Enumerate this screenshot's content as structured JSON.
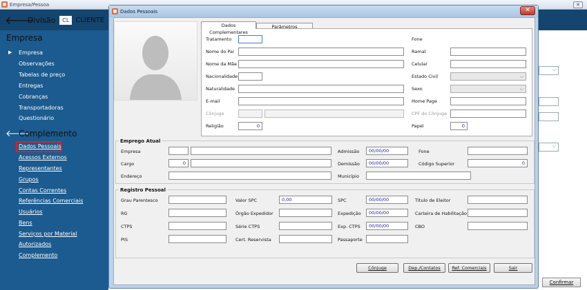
{
  "window": {
    "title": "Empresa/Pessoa",
    "close": "✕"
  },
  "nav": {
    "back": "🡐",
    "division": "Divisão",
    "cl": "CL",
    "client": "CLIENTE"
  },
  "sidebar": {
    "section1": "Empresa",
    "arrow": "▶",
    "items": [
      "Empresa",
      "Observações",
      "Tabelas de preço",
      "Entregas",
      "Cobranças",
      "Transportadoras",
      "Questionário"
    ],
    "section2": "Complemento",
    "links": [
      "Dados Pessoais",
      "Acessos Externos",
      "Representantes",
      "Grupos",
      "Contas Correntes",
      "Referências Comerciais",
      "Usuários",
      "Bens",
      "Serviços por Material",
      "Autorizados",
      "Complemento"
    ]
  },
  "background": {
    "confirm": "Confirmar"
  },
  "dialog": {
    "title": "Dados Pessoais",
    "close": "✕"
  },
  "tabs": [
    "Dados Complementares",
    "Parâmetros"
  ],
  "complementares": {
    "tratamento": "Tratamento",
    "nome_pai": "Nome do Pai",
    "nome_mae": "Nome da Mãe",
    "nacionalidade": "Nacionalidade",
    "naturalidade": "Naturalidade",
    "email": "E-mail",
    "conjuge": "Cônjuge",
    "religiao": "Religião",
    "religiao_val": "0",
    "fone": "Fone",
    "ramal": "Ramal",
    "celular": "Celular",
    "estado_civil": "Estado Civil",
    "sexo": "Sexo",
    "home_page": "Home Page",
    "cpf_conjuge": "CPF do Cônjuge",
    "papel": "Papel",
    "papel_val": "0",
    "dropdown": "⌵"
  },
  "emprego": {
    "title": "Emprego Atual",
    "empresa": "Empresa",
    "cargo": "Cargo",
    "cargo_val": "0",
    "endereco": "Endereço",
    "admissao": "Admissão",
    "admissao_val": "00/00/00",
    "demissao": "Demissão",
    "demissao_val": "00/00/00",
    "municipio": "Município",
    "fone": "Fone",
    "codigo_superior": "Código Superior",
    "codigo_superior_val": "0"
  },
  "registro": {
    "title": "Registro Pessoal",
    "grau": "Grau Parentesco",
    "rg": "RG",
    "ctps": "CTPS",
    "pis": "PIS",
    "valor_spc": "Valor SPC",
    "valor_spc_val": "0,00",
    "orgao": "Órgão Expedidor",
    "serie_ctps": "Série CTPS",
    "cert_reservista": "Cert. Reservista",
    "spc": "SPC",
    "spc_val": "00/00/00",
    "expedicao": "Expedição",
    "expedicao_val": "00/00/00",
    "exp_ctps": "Exp. CTPS",
    "exp_ctps_val": "00/00/00",
    "passaporte": "Passaporte",
    "titulo_eleitor": "Título de Eleitor",
    "carteira": "Carteira de Habilitação",
    "cbo": "CBO"
  },
  "buttons": {
    "conjuge": "Cônjuge",
    "dep": "Dep./Contatos",
    "ref": "Ref. Comerciais",
    "sair": "Sair"
  }
}
